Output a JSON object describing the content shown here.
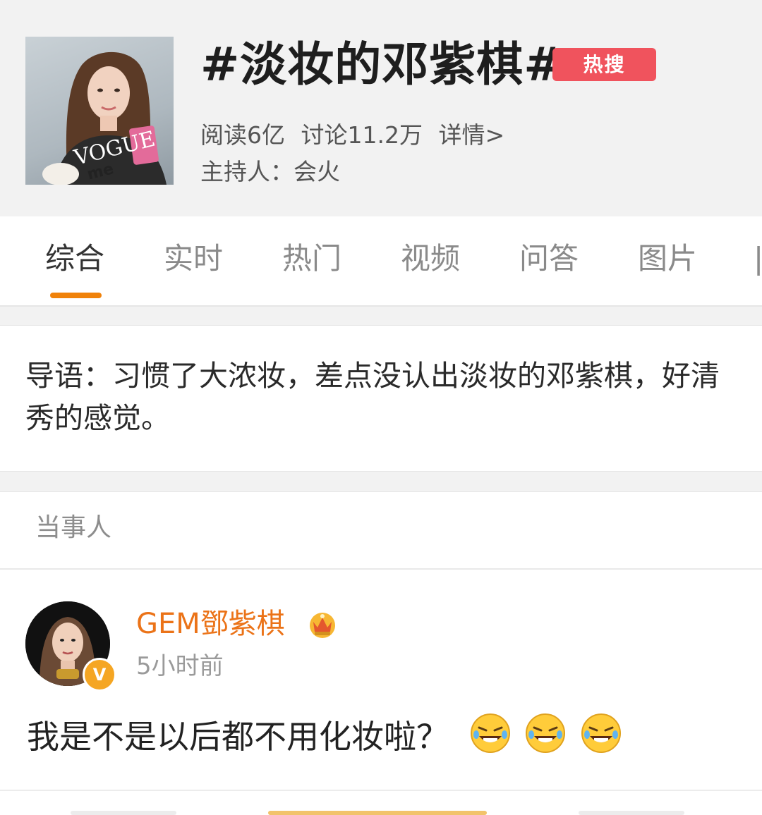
{
  "topic": {
    "title": "#淡妆的邓紫棋#",
    "badge": "热搜",
    "stats": {
      "read": "阅读6亿",
      "discuss": "讨论11.2万",
      "details_link": "详情>"
    },
    "host": "主持人：会火",
    "cover_watermark": "VOGUE me"
  },
  "tabs": [
    {
      "label": "综合",
      "active": true
    },
    {
      "label": "实时"
    },
    {
      "label": "热门"
    },
    {
      "label": "视频"
    },
    {
      "label": "问答"
    },
    {
      "label": "图片"
    }
  ],
  "intro": {
    "text": "导语：习惯了大浓妆，差点没认出淡妆的邓紫棋，好清秀的感觉。"
  },
  "section": {
    "label": "当事人"
  },
  "post": {
    "user_name": "GEM鄧紫棋",
    "verified_badge": "V",
    "time": "5小时前",
    "text": "我是不是以后都不用化妆啦？",
    "emoji_count": 3
  },
  "colors": {
    "accent": "#f0820a",
    "badge_red": "#f0535d",
    "username_orange": "#eb7318",
    "verify_gold": "#f5a623"
  },
  "icons": [
    "crown-icon",
    "laughing-emoji-icon",
    "verified-icon"
  ]
}
